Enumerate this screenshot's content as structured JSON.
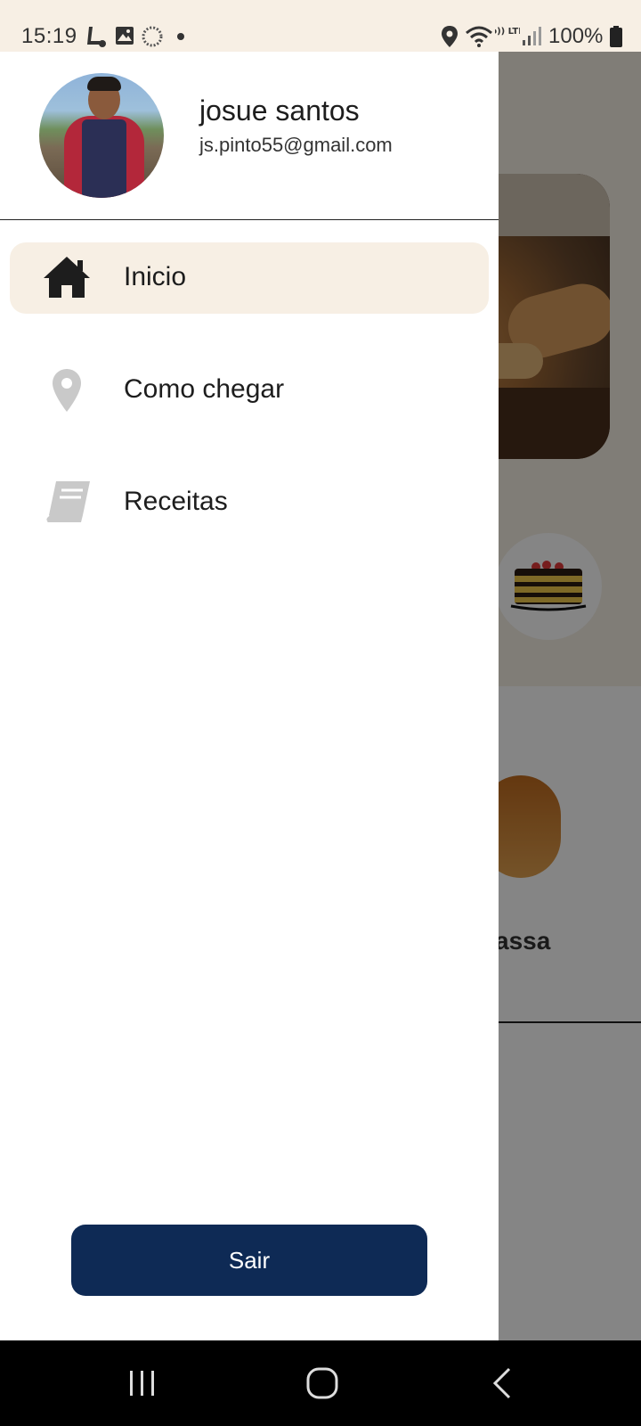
{
  "status_bar": {
    "time": "15:19",
    "battery": "100%",
    "volte_label": "Vo)) LTE1",
    "icons": [
      "tasker-icon",
      "gallery-icon",
      "sync-icon",
      "dot-icon",
      "location-icon",
      "wifi-icon",
      "volte-icon",
      "signal-icon",
      "battery-icon"
    ]
  },
  "drawer": {
    "user": {
      "name": "josue santos",
      "email": "js.pinto55@gmail.com"
    },
    "items": [
      {
        "label": "Inicio",
        "icon": "home-icon",
        "active": true
      },
      {
        "label": "Como chegar",
        "icon": "map-pin-icon",
        "active": false
      },
      {
        "label": "Receitas",
        "icon": "book-icon",
        "active": false
      }
    ],
    "logout_label": "Sair"
  },
  "background": {
    "card_title_partial": "assa"
  },
  "colors": {
    "status_bg": "#f7efe4",
    "active_item_bg": "#f7efe4",
    "logout_bg": "#0e2a55",
    "scrim": "rgba(0,0,0,0.48)"
  },
  "system_nav": {
    "buttons": [
      "recent-apps-icon",
      "home-circle-icon",
      "back-icon"
    ]
  }
}
